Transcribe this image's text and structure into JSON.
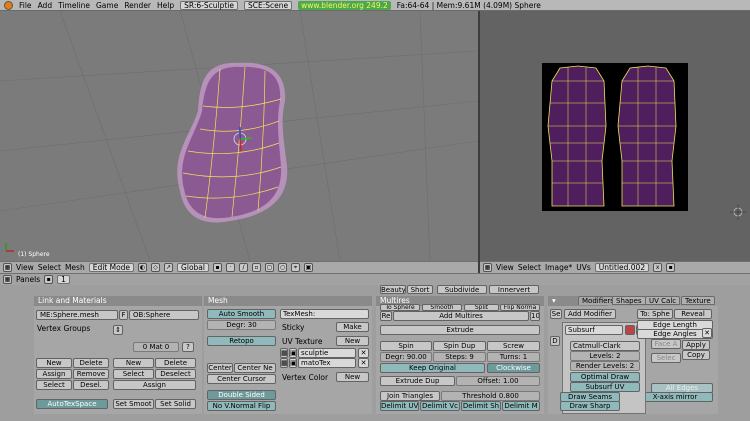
{
  "menu": {
    "icon": "blender-logo-icon",
    "file": "File",
    "add": "Add",
    "timeline": "Timeline",
    "game": "Game",
    "render": "Render",
    "help": "Help",
    "screen": "SR:6-Sculptie",
    "scene": "SCE:Scene",
    "url": "www.blender.org 249.2",
    "stats": "Fa:64-64 | Mem:9.61M (4.09M) Sphere"
  },
  "view3d": {
    "object_label": "(1) Sphere",
    "header": {
      "view": "View",
      "select": "Select",
      "mesh": "Mesh",
      "mode": "Edit Mode",
      "orient": "Global"
    }
  },
  "uv": {
    "header": {
      "view": "View",
      "select": "Select",
      "image": "Image*",
      "uvs": "UVs",
      "image_name": "Untitled.002"
    }
  },
  "panels_bar": {
    "label": "Panels",
    "frame": "1"
  },
  "link": {
    "title": "Link and Materials",
    "me": "ME:Sphere.mesh",
    "f": "F",
    "ob": "OB:Sphere",
    "vertex_groups": "Vertex Groups",
    "mat": "0 Mat 0",
    "q": "?",
    "new": "New",
    "delete": "Delete",
    "assign": "Assign",
    "remove": "Remove",
    "select": "Select",
    "desel": "Desel.",
    "new2": "New",
    "delete2": "Delete",
    "select2": "Select",
    "deselect2": "Deselect",
    "assign2": "Assign",
    "autotex": "AutoTexSpace",
    "set_smoot": "Set Smoot",
    "set_solid": "Set Solid"
  },
  "mesh": {
    "title": "Mesh",
    "auto_smooth": "Auto Smooth",
    "degr": "Degr: 30",
    "retopo": "Retopo",
    "center": "Center",
    "center_ne": "Center Ne",
    "center_cursor": "Center Cursor",
    "double_sided": "Double Sided",
    "no_vnormal": "No V.Normal Flip",
    "texmesh": "TexMesh:",
    "sticky": "Sticky",
    "make": "Make",
    "uv_texture": "UV Texture",
    "new": "New",
    "uv1": "sculptie",
    "uv2": "matoTex",
    "vertex_color": "Vertex Color",
    "new2": "New"
  },
  "multires": {
    "title": "Multires",
    "peek1": "Beauty",
    "peek2": "Short",
    "peek3": "Subdivide",
    "peek4": "Innervert",
    "peek5": "To Sphere",
    "peek6": "Smooth",
    "peek7": "Split",
    "peek8": "Flip Norma",
    "re": "Re",
    "add_multires": "Add Multires",
    "num": "10",
    "extrude": "Extrude",
    "spin": "Spin",
    "spin_dup": "Spin Dup",
    "screw": "Screw",
    "degr": "Degr: 90.00",
    "steps": "Steps: 9",
    "turns": "Turns: 1",
    "keep_original": "Keep Original",
    "clockwise": "Clockwise",
    "extrude_dup": "Extrude Dup",
    "offset": "Offset: 1.00",
    "join_triangles": "Join Triangles",
    "threshold": "Threshold 0.800",
    "delimit_uv": "Delimit UV",
    "delimit_vc": "Delimit Vc",
    "delimit_sh": "Delimit Sh",
    "delimit_m": "Delimit M"
  },
  "modifiers": {
    "tab1": "Modifiers",
    "tab2": "Shapes",
    "tab3": "UV Calc",
    "tab4": "Texture",
    "add_modifier": "Add Modifier",
    "to": "To: Sphe",
    "subsurf": "Subsurf",
    "catmull": "Catmull-Clark",
    "levels": "Levels: 2",
    "render_levels": "Render Levels: 2",
    "optimal": "Optimal Draw",
    "subsurf_uv": "Subsurf UV",
    "draw_seams": "Draw Seams",
    "draw_sharp": "Draw Sharp",
    "reveal": "Reveal",
    "edge_length": "Edge Length",
    "edge_angles": "Edge Angles",
    "face_a": "Face A",
    "select": "Selec",
    "apply": "Apply",
    "copy": "Copy",
    "all_edges": "All Edges",
    "xaxis": "X-axis mirror",
    "s": "Se",
    "d": "D"
  },
  "colors": {
    "mesh_fill": "#8c5a92",
    "uv_fill": "#4e1f5c",
    "edge": "#f2e25a",
    "select_outline": "#e9a2f0"
  }
}
